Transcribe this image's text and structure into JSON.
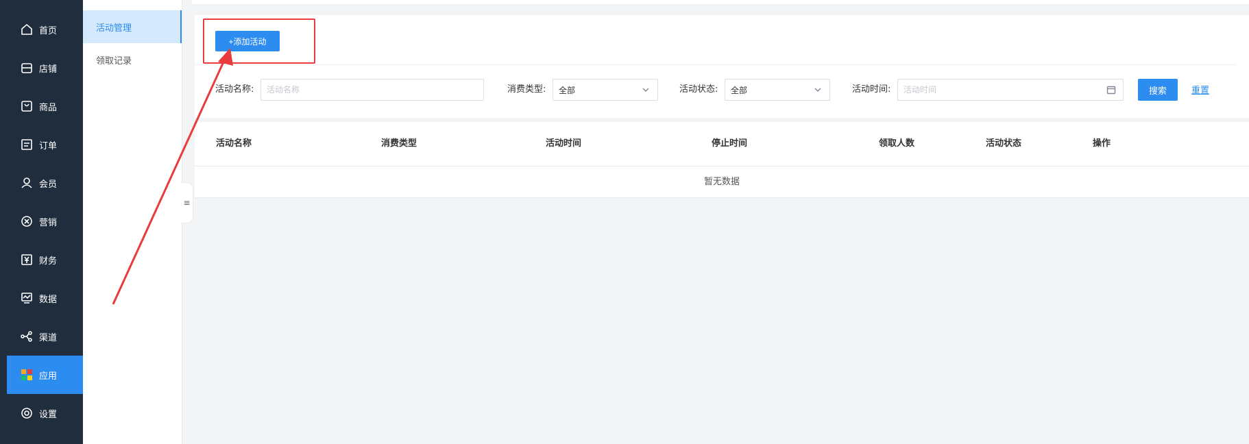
{
  "nav": {
    "items": [
      {
        "label": "首页",
        "icon": "home-icon",
        "active": false
      },
      {
        "label": "店铺",
        "icon": "store-icon",
        "active": false
      },
      {
        "label": "商品",
        "icon": "goods-icon",
        "active": false
      },
      {
        "label": "订单",
        "icon": "order-icon",
        "active": false
      },
      {
        "label": "会员",
        "icon": "member-icon",
        "active": false
      },
      {
        "label": "营销",
        "icon": "marketing-icon",
        "active": false
      },
      {
        "label": "财务",
        "icon": "finance-icon",
        "active": false
      },
      {
        "label": "数据",
        "icon": "data-icon",
        "active": false
      },
      {
        "label": "渠道",
        "icon": "channel-icon",
        "active": false
      },
      {
        "label": "应用",
        "icon": "apps-icon",
        "active": true
      },
      {
        "label": "设置",
        "icon": "settings-icon",
        "active": false
      }
    ]
  },
  "subnav": {
    "items": [
      {
        "label": "活动管理",
        "active": true
      },
      {
        "label": "领取记录",
        "active": false
      }
    ]
  },
  "toolbar": {
    "add_label": "+添加活动"
  },
  "filters": {
    "name_label": "活动名称:",
    "name_placeholder": "活动名称",
    "type_label": "消费类型:",
    "type_value": "全部",
    "status_label": "活动状态:",
    "status_value": "全部",
    "time_label": "活动时间:",
    "time_placeholder": "活动时间",
    "search_label": "搜索",
    "reset_label": "重置"
  },
  "table": {
    "columns": [
      "活动名称",
      "消费类型",
      "活动时间",
      "停止时间",
      "领取人数",
      "活动状态",
      "操作"
    ],
    "empty_text": "暂无数据"
  },
  "colors": {
    "nav_bg": "#1f2d3d",
    "accent": "#2d8cf0",
    "annotation": "#e93b3b"
  }
}
